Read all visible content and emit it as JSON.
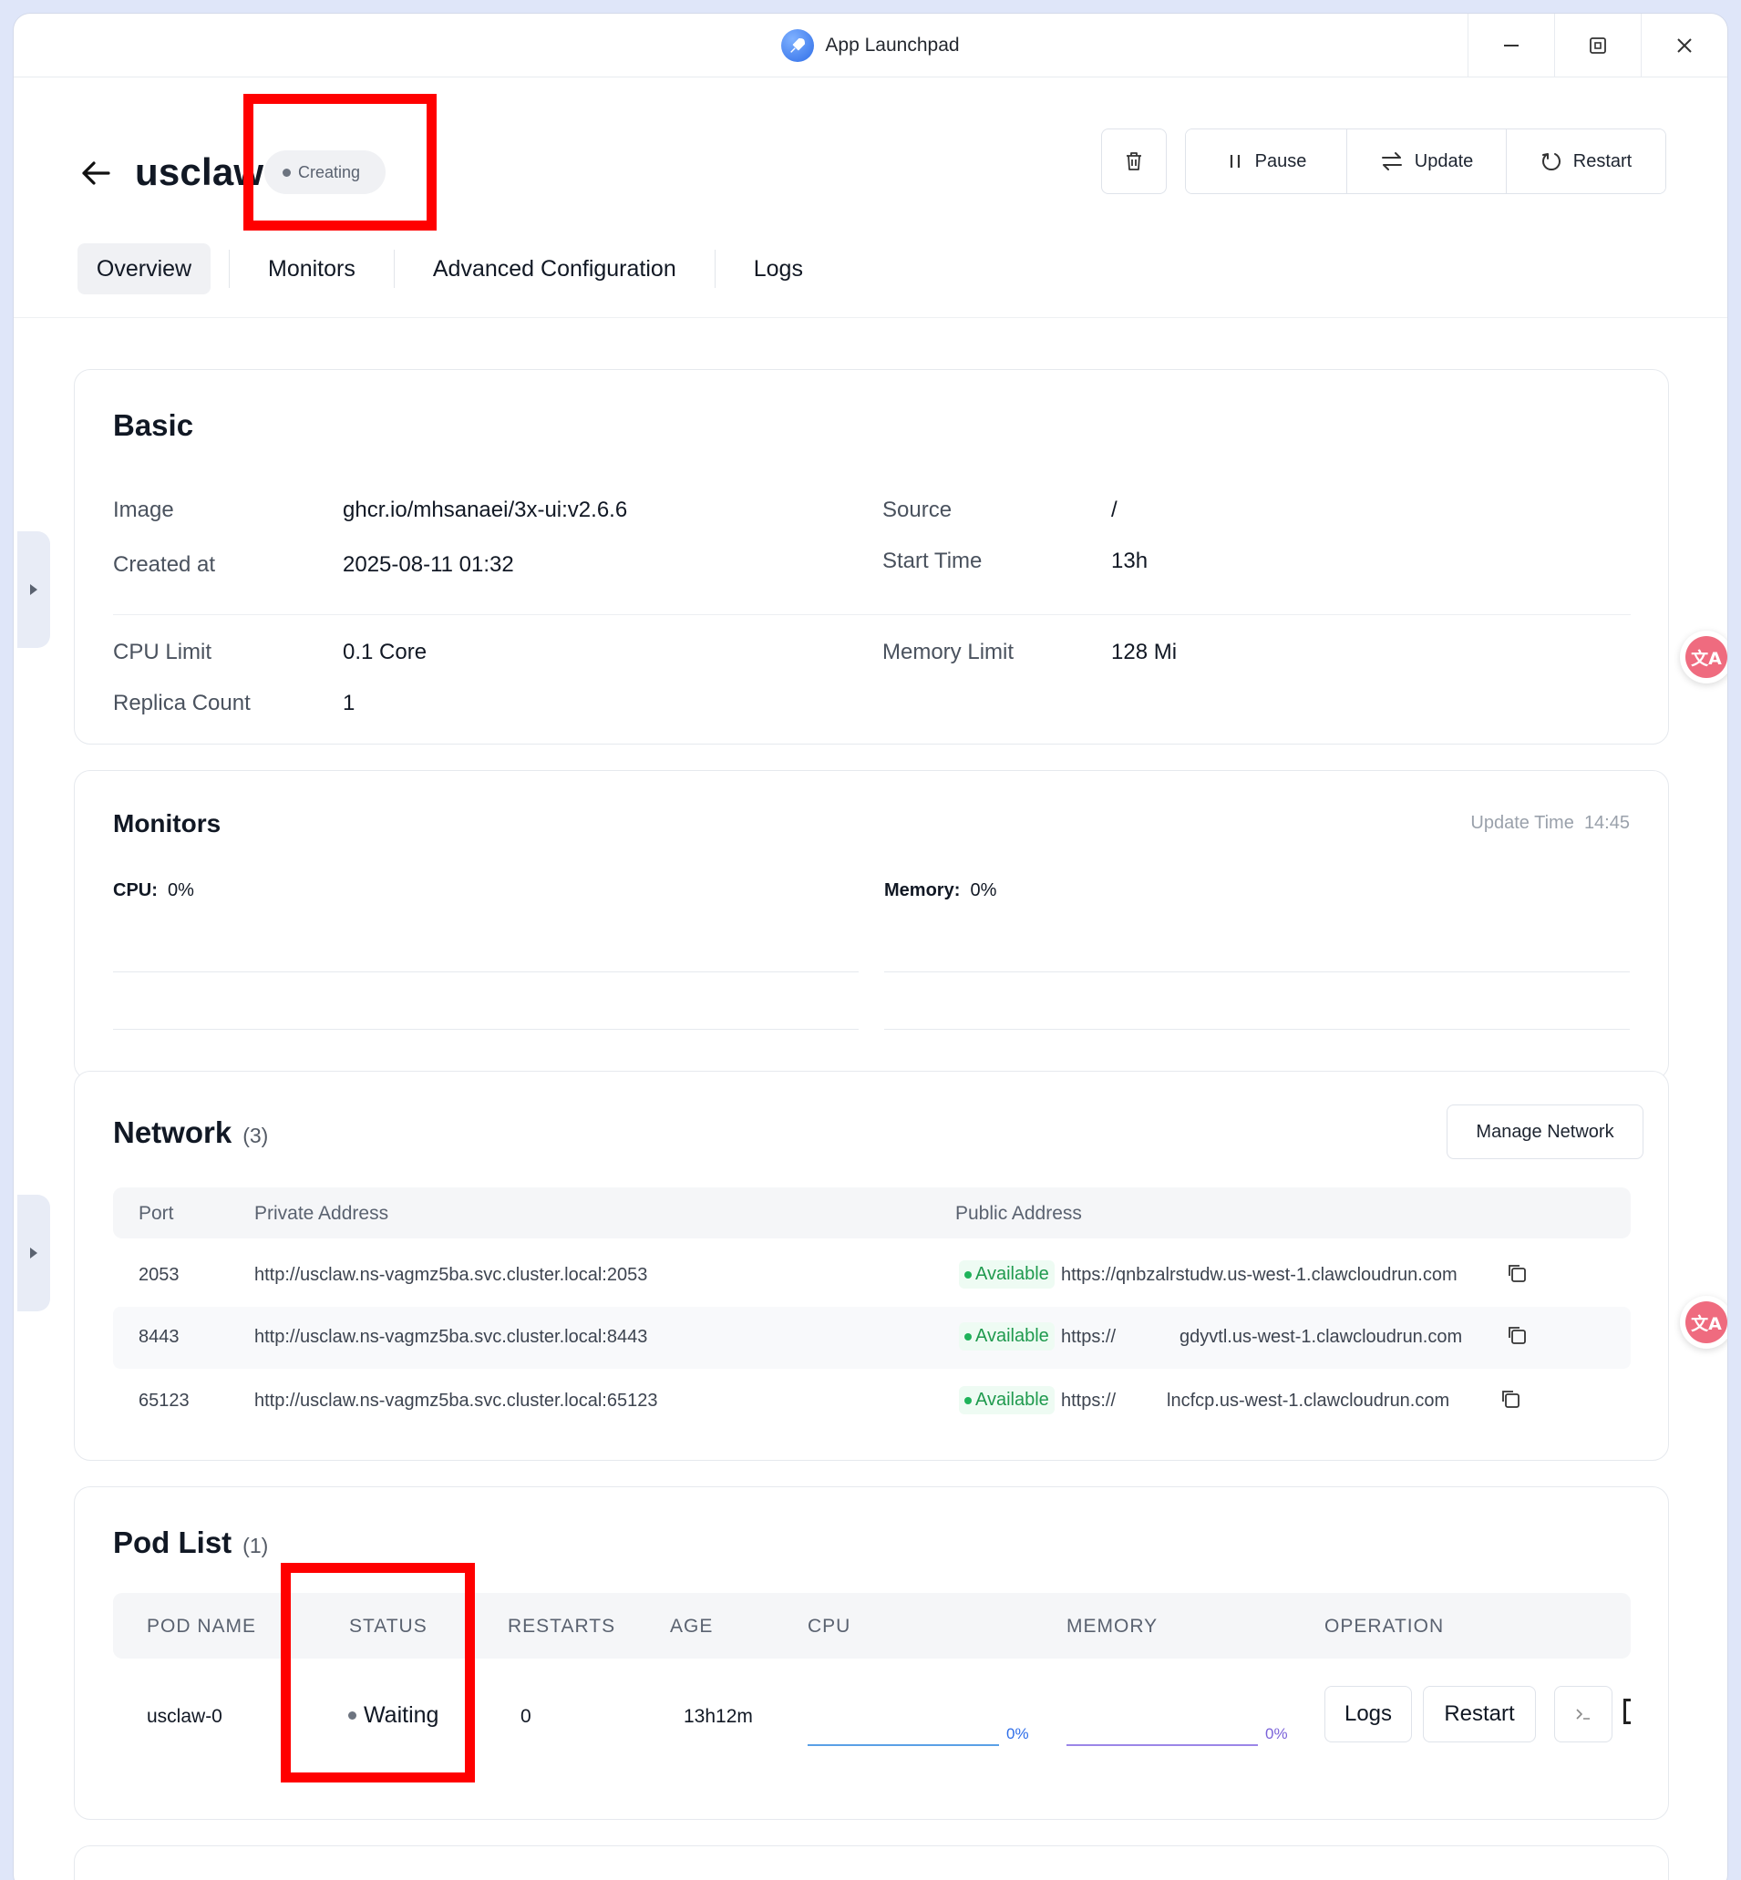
{
  "window": {
    "title": "App Launchpad"
  },
  "header": {
    "app_name": "usclaw",
    "status": "Creating",
    "actions": {
      "pause": "Pause",
      "update": "Update",
      "restart": "Restart"
    }
  },
  "tabs": [
    {
      "label": "Overview",
      "active": true
    },
    {
      "label": "Monitors",
      "active": false
    },
    {
      "label": "Advanced Configuration",
      "active": false
    },
    {
      "label": "Logs",
      "active": false
    }
  ],
  "basic": {
    "title": "Basic",
    "image_label": "Image",
    "image_value": "ghcr.io/mhsanaei/3x-ui:v2.6.6",
    "source_label": "Source",
    "source_value": "/",
    "created_label": "Created at",
    "created_value": "2025-08-11 01:32",
    "start_label": "Start Time",
    "start_value": "13h",
    "cpu_label": "CPU Limit",
    "cpu_value": "0.1 Core",
    "memory_label": "Memory Limit",
    "memory_value": "128 Mi",
    "replica_label": "Replica Count",
    "replica_value": "1"
  },
  "monitors": {
    "title": "Monitors",
    "update_time_label": "Update Time",
    "update_time_value": "14:45",
    "cpu_label": "CPU:",
    "cpu_value": "0%",
    "memory_label": "Memory:",
    "memory_value": "0%"
  },
  "network": {
    "title": "Network",
    "count": "(3)",
    "manage_button": "Manage Network",
    "columns": {
      "port": "Port",
      "private": "Private Address",
      "public": "Public Address"
    },
    "rows": [
      {
        "port": "2053",
        "private": "http://usclaw.ns-vagmz5ba.svc.cluster.local:2053",
        "status": "Available",
        "public": "https://qnbzalrstudw.us-west-1.clawcloudrun.com"
      },
      {
        "port": "8443",
        "private": "http://usclaw.ns-vagmz5ba.svc.cluster.local:8443",
        "status": "Available",
        "public_prefix": "https://",
        "public_suffix": "gdyvtl.us-west-1.clawcloudrun.com"
      },
      {
        "port": "65123",
        "private": "http://usclaw.ns-vagmz5ba.svc.cluster.local:65123",
        "status": "Available",
        "public_prefix": "https://",
        "public_suffix": "lncfcp.us-west-1.clawcloudrun.com"
      }
    ]
  },
  "pods": {
    "title": "Pod List",
    "count": "(1)",
    "columns": {
      "name": "POD NAME",
      "status": "STATUS",
      "restarts": "RESTARTS",
      "age": "AGE",
      "cpu": "CPU",
      "memory": "MEMORY",
      "operation": "OPERATION"
    },
    "rows": [
      {
        "name": "usclaw-0",
        "status": "Waiting",
        "restarts": "0",
        "age": "13h12m",
        "cpu": "0%",
        "memory": "0%",
        "logs_button": "Logs",
        "restart_button": "Restart"
      }
    ]
  },
  "colors": {
    "accent": "#2f6ee8",
    "available": "#1f9a4e",
    "highlight": "#ff0000",
    "cpu_line": "#5aa0e6",
    "memory_line": "#9b86e8"
  }
}
